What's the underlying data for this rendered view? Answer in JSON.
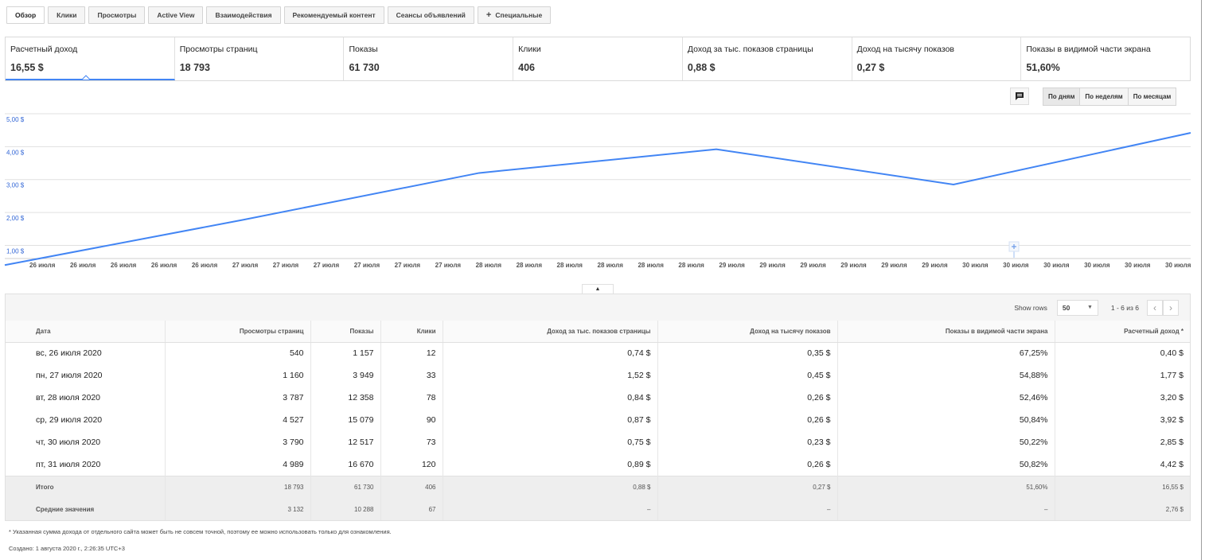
{
  "tabs": [
    {
      "label": "Обзор",
      "active": true
    },
    {
      "label": "Клики"
    },
    {
      "label": "Просмотры"
    },
    {
      "label": "Active View"
    },
    {
      "label": "Взаимодействия"
    },
    {
      "label": "Рекомендуемый контент"
    },
    {
      "label": "Сеансы объявлений"
    },
    {
      "label": "Специальные",
      "icon": "plus-icon"
    }
  ],
  "metrics": [
    {
      "label": "Расчетный доход",
      "value": "16,55 $",
      "active": true
    },
    {
      "label": "Просмотры страниц",
      "value": "18 793"
    },
    {
      "label": "Показы",
      "value": "61 730"
    },
    {
      "label": "Клики",
      "value": "406"
    },
    {
      "label": "Доход за тыс. показов страницы",
      "value": "0,88 $"
    },
    {
      "label": "Доход на тысячу показов",
      "value": "0,27 $"
    },
    {
      "label": "Показы в видимой части экрана",
      "value": "51,60%"
    }
  ],
  "period_buttons": [
    {
      "label": "По дням",
      "active": true
    },
    {
      "label": "По неделям"
    },
    {
      "label": "По месяцам"
    }
  ],
  "colors": {
    "line": "#4285f4",
    "axis_label": "#3367d6",
    "accent": "#4285f4"
  },
  "chart_data": {
    "type": "line",
    "y_ticks": [
      "1,00 $",
      "2,00 $",
      "3,00 $",
      "4,00 $",
      "5,00 $"
    ],
    "ylim": [
      0.6,
      5.0
    ],
    "x_tick_labels": [
      "26 июля",
      "26 июля",
      "26 июля",
      "26 июля",
      "26 июля",
      "27 июля",
      "27 июля",
      "27 июля",
      "27 июля",
      "27 июля",
      "27 июля",
      "28 июля",
      "28 июля",
      "28 июля",
      "28 июля",
      "28 июля",
      "28 июля",
      "29 июля",
      "29 июля",
      "29 июля",
      "29 июля",
      "29 июля",
      "29 июля",
      "30 июля",
      "30 июля",
      "30 июля",
      "30 июля",
      "30 июля",
      "30 июля"
    ],
    "series": [
      {
        "x": [
          "26 июля 2020",
          "27 июля 2020",
          "28 июля 2020",
          "29 июля 2020",
          "30 июля 2020",
          "31 июля 2020"
        ],
        "values": [
          0.4,
          1.77,
          3.2,
          3.92,
          2.85,
          4.42
        ]
      }
    ],
    "grid": true
  },
  "table": {
    "show_rows_label": "Show rows",
    "rows_per_page": "50",
    "range_label": "1 - 6 из 6",
    "columns": [
      "Дата",
      "Просмотры страниц",
      "Показы",
      "Клики",
      "Доход за тыс. показов страницы",
      "Доход на тысячу показов",
      "Показы в видимой части экрана",
      "Расчетный доход *"
    ],
    "rows": [
      [
        "вс, 26 июля 2020",
        "540",
        "1 157",
        "12",
        "0,74 $",
        "0,35 $",
        "67,25%",
        "0,40 $"
      ],
      [
        "пн, 27 июля 2020",
        "1 160",
        "3 949",
        "33",
        "1,52 $",
        "0,45 $",
        "54,88%",
        "1,77 $"
      ],
      [
        "вт, 28 июля 2020",
        "3 787",
        "12 358",
        "78",
        "0,84 $",
        "0,26 $",
        "52,46%",
        "3,20 $"
      ],
      [
        "ср, 29 июля 2020",
        "4 527",
        "15 079",
        "90",
        "0,87 $",
        "0,26 $",
        "50,84%",
        "3,92 $"
      ],
      [
        "чт, 30 июля 2020",
        "3 790",
        "12 517",
        "73",
        "0,75 $",
        "0,23 $",
        "50,22%",
        "2,85 $"
      ],
      [
        "пт, 31 июля 2020",
        "4 989",
        "16 670",
        "120",
        "0,89 $",
        "0,26 $",
        "50,82%",
        "4,42 $"
      ]
    ],
    "total": [
      "Итого",
      "18 793",
      "61 730",
      "406",
      "0,88 $",
      "0,27 $",
      "51,60%",
      "16,55 $"
    ],
    "average": [
      "Средние значения",
      "3 132",
      "10 288",
      "67",
      "–",
      "–",
      "–",
      "2,76 $"
    ]
  },
  "footnote": "* Указанная сумма дохода от отдельного сайта может быть не совсем точной, поэтому ее можно использовать только для ознакомления.",
  "created": "Создано: 1 августа 2020 г., 2:26:35 UTC+3"
}
